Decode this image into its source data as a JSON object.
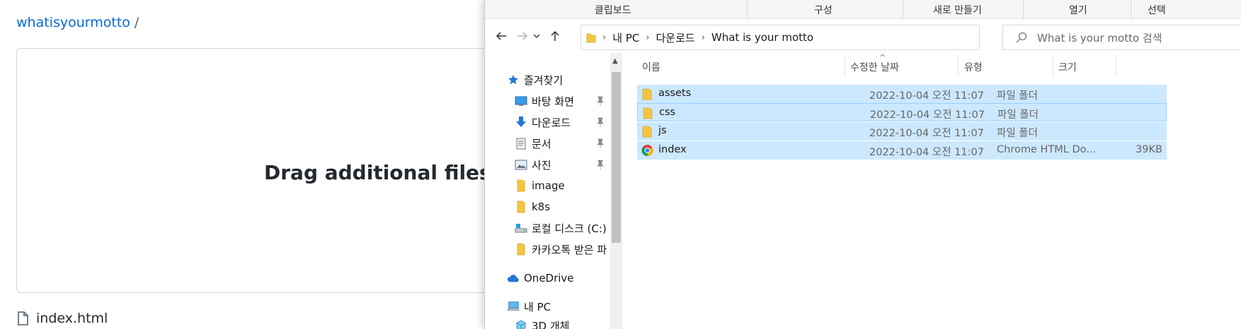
{
  "github": {
    "breadcrumb_repo": "whatisyourmotto",
    "breadcrumb_sep": "/",
    "drop_text": "Drag additional files h",
    "file_name": "index.html"
  },
  "explorer": {
    "ribbon": [
      "클립보드",
      "구성",
      "새로 만들기",
      "열기",
      "선택"
    ],
    "address": {
      "segments": [
        "내 PC",
        "다운로드",
        "What is your motto"
      ]
    },
    "search_placeholder": "What is your motto 검색",
    "nav": {
      "quick_access": "즐겨찾기",
      "desktop": "바탕 화면",
      "downloads": "다운로드",
      "documents": "문서",
      "pictures": "사진",
      "image": "image",
      "k8s": "k8s",
      "local_disk": "로컬 디스크 (C:)",
      "kakaotalk": "카카오톡 받은 파",
      "onedrive": "OneDrive",
      "this_pc": "내 PC",
      "objects3d": "3D 개체"
    },
    "columns": {
      "name": "이름",
      "date": "수정한 날짜",
      "type": "유형",
      "size": "크기"
    },
    "files": [
      {
        "name": "assets",
        "date": "2022-10-04 오전 11:07",
        "type": "파일 폴더",
        "size": ""
      },
      {
        "name": "css",
        "date": "2022-10-04 오전 11:07",
        "type": "파일 폴더",
        "size": ""
      },
      {
        "name": "js",
        "date": "2022-10-04 오전 11:07",
        "type": "파일 폴더",
        "size": ""
      },
      {
        "name": "index",
        "date": "2022-10-04 오전 11:07",
        "type": "Chrome HTML Do...",
        "size": "39KB"
      }
    ]
  },
  "colors": {
    "link_blue": "#0969da",
    "selection": "#cce8ff",
    "selection_border": "#99d1ff",
    "folder_yellow": "#f5c542"
  }
}
